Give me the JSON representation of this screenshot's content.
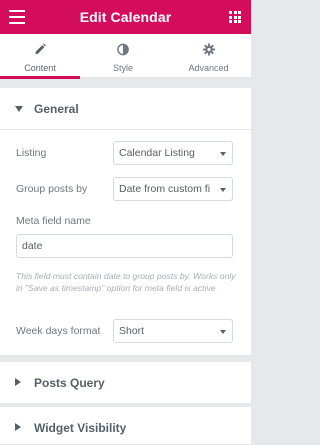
{
  "header": {
    "title": "Edit Calendar",
    "menu_icon": "hamburger-icon",
    "apps_icon": "grid-icon"
  },
  "tabs": [
    {
      "label": "Content",
      "icon": "pencil-icon",
      "active": true
    },
    {
      "label": "Style",
      "icon": "contrast-icon",
      "active": false
    },
    {
      "label": "Advanced",
      "icon": "gear-icon",
      "active": false
    }
  ],
  "sections": {
    "general": {
      "title": "General",
      "expanded": true,
      "fields": {
        "listing": {
          "label": "Listing",
          "value": "Calendar Listing"
        },
        "group_posts_by": {
          "label": "Group posts by",
          "value": "Date from custom fi"
        },
        "meta_field_name": {
          "label": "Meta field name",
          "value": "date"
        },
        "hint": "This field must contain date to group posts by. Works only in \"Save as timestamp\" option for meta field is active",
        "week_days_format": {
          "label": "Week days format",
          "value": "Short"
        }
      }
    },
    "posts_query": {
      "title": "Posts Query",
      "expanded": false
    },
    "widget_visibility": {
      "title": "Widget Visibility",
      "expanded": false
    }
  },
  "colors": {
    "accent": "#d30c5c",
    "panel_bg": "#ffffff",
    "page_bg": "#e6e9ec"
  }
}
